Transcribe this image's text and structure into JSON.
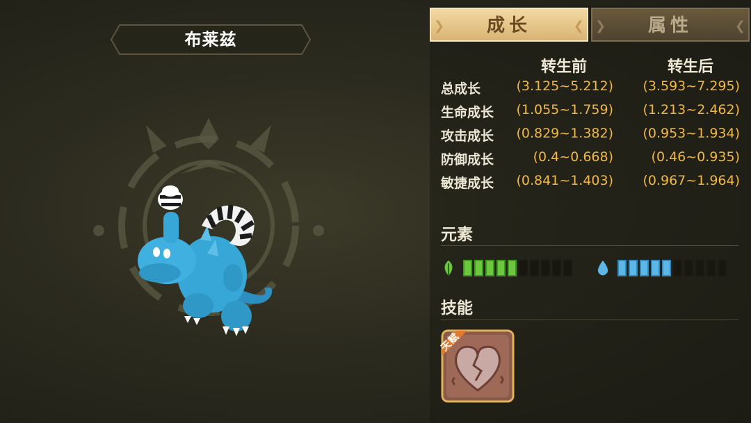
{
  "pet": {
    "name": "布莱兹"
  },
  "tabs": [
    {
      "label": "成长",
      "active": true
    },
    {
      "label": "属性",
      "active": false
    }
  ],
  "growth": {
    "columns": {
      "before": "转生前",
      "after": "转生后"
    },
    "rows": [
      {
        "label": "总成长",
        "before": "(3.125~5.212)",
        "after": "(3.593~7.295)"
      },
      {
        "label": "生命成长",
        "before": "(1.055~1.759)",
        "after": "(1.213~2.462)"
      },
      {
        "label": "攻击成长",
        "before": "(0.829~1.382)",
        "after": "(0.953~1.934)"
      },
      {
        "label": "防御成长",
        "before": "(0.4~0.668)",
        "after": "(0.46~0.935)"
      },
      {
        "label": "敏捷成长",
        "before": "(0.841~1.403)",
        "after": "(0.967~1.964)"
      }
    ]
  },
  "elements": {
    "title": "元素",
    "items": [
      {
        "name": "wind",
        "icon": "leaf-icon",
        "level": 5,
        "max": 10,
        "color": "#6cc640"
      },
      {
        "name": "water",
        "icon": "water-drop-icon",
        "level": 5,
        "max": 10,
        "color": "#5cb7e6"
      }
    ]
  },
  "skills": {
    "title": "技能",
    "items": [
      {
        "icon": "broken-heart-icon",
        "badge": "天赋"
      }
    ]
  },
  "colors": {
    "value_text": "#f1b843",
    "active_tab": "#e8c88a",
    "inactive_tab": "#5e513a"
  }
}
